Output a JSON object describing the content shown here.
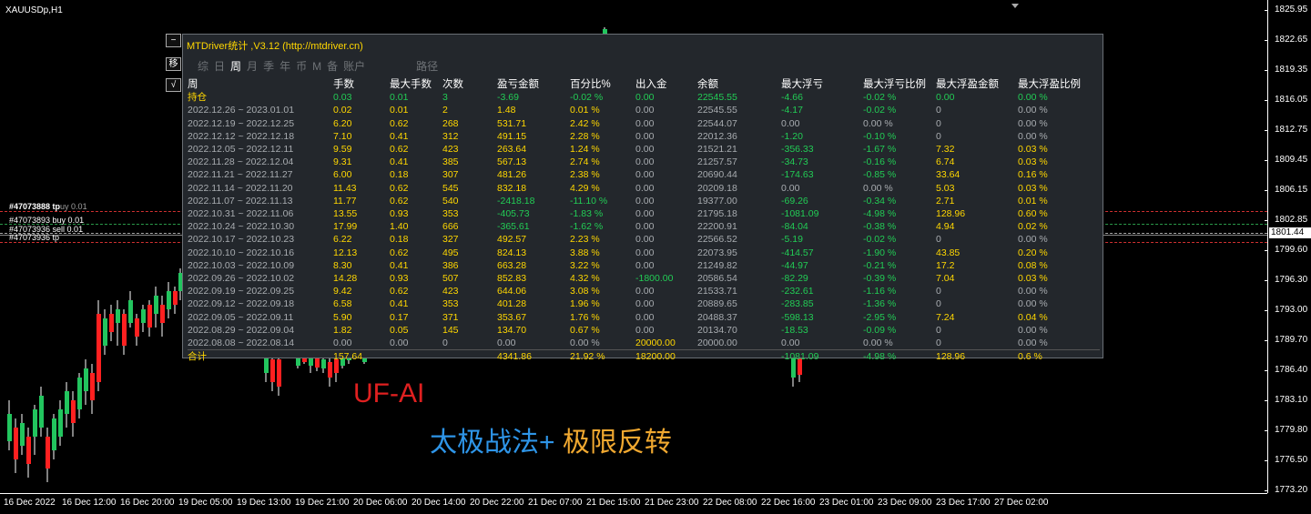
{
  "symbol": "XAUUSDp,H1",
  "colors": {
    "white": "#ffffff",
    "yellow": "#ffd700",
    "green": "#22cc55",
    "gray": "#a8acb0",
    "red": "#e03030"
  },
  "price_axis": {
    "ticks": [
      "1825.95",
      "1822.65",
      "1819.35",
      "1816.05",
      "1812.75",
      "1809.45",
      "1806.15",
      "1802.85",
      "1799.60",
      "1796.30",
      "1793.00",
      "1789.70",
      "1786.40",
      "1783.10",
      "1779.80",
      "1776.50",
      "1773.20"
    ],
    "current": "1801.44"
  },
  "time_axis": [
    "16 Dec 2022",
    "16 Dec 12:00",
    "16 Dec 20:00",
    "19 Dec 05:00",
    "19 Dec 13:00",
    "19 Dec 21:00",
    "20 Dec 06:00",
    "20 Dec 14:00",
    "20 Dec 22:00",
    "21 Dec 07:00",
    "21 Dec 15:00",
    "21 Dec 23:00",
    "22 Dec 08:00",
    "22 Dec 16:00",
    "23 Dec 01:00",
    "23 Dec 09:00",
    "23 Dec 17:00",
    "27 Dec 02:00"
  ],
  "orders": [
    "#47073888 tp",
    "#47073893 buy 0.01",
    "#47073936 sell 0.01",
    "#47073936 tp"
  ],
  "order_overlap": "uy 0.01",
  "side_buttons": [
    "−",
    "移",
    "√"
  ],
  "panel": {
    "title": "MTDriver统计 ,V3.12 (http://mtdriver.cn)",
    "tabs": [
      "综",
      "日",
      "周",
      "月",
      "季",
      "年",
      "币",
      "M",
      "备",
      "账户",
      "路径"
    ],
    "active_tab": "周",
    "headers": [
      "周",
      "手数",
      "最大手数",
      "次数",
      "盈亏金额",
      "百分比%",
      "出入金",
      "余额",
      "最大浮亏",
      "最大浮亏比例",
      "最大浮盈金额",
      "最大浮盈比例"
    ],
    "rows": [
      [
        "持仓",
        "0.03",
        "0.01",
        "3",
        "-3.69",
        "-0.02 %",
        "0.00",
        "22545.55",
        "-4.66",
        "-0.02 %",
        "0.00",
        "0.00 %"
      ],
      [
        "2022.12.26 ~ 2023.01.01",
        "0.02",
        "0.01",
        "2",
        "1.48",
        "0.01 %",
        "0.00",
        "22545.55",
        "-4.17",
        "-0.02 %",
        "0",
        "0.00 %"
      ],
      [
        "2022.12.19 ~ 2022.12.25",
        "6.20",
        "0.62",
        "268",
        "531.71",
        "2.42 %",
        "0.00",
        "22544.07",
        "0.00",
        "0.00 %",
        "0",
        "0.00 %"
      ],
      [
        "2022.12.12 ~ 2022.12.18",
        "7.10",
        "0.41",
        "312",
        "491.15",
        "2.28 %",
        "0.00",
        "22012.36",
        "-1.20",
        "-0.10 %",
        "0",
        "0.00 %"
      ],
      [
        "2022.12.05 ~ 2022.12.11",
        "9.59",
        "0.62",
        "423",
        "263.64",
        "1.24 %",
        "0.00",
        "21521.21",
        "-356.33",
        "-1.67 %",
        "7.32",
        "0.03 %"
      ],
      [
        "2022.11.28 ~ 2022.12.04",
        "9.31",
        "0.41",
        "385",
        "567.13",
        "2.74 %",
        "0.00",
        "21257.57",
        "-34.73",
        "-0.16 %",
        "6.74",
        "0.03 %"
      ],
      [
        "2022.11.21 ~ 2022.11.27",
        "6.00",
        "0.18",
        "307",
        "481.26",
        "2.38 %",
        "0.00",
        "20690.44",
        "-174.63",
        "-0.85 %",
        "33.64",
        "0.16 %"
      ],
      [
        "2022.11.14 ~ 2022.11.20",
        "11.43",
        "0.62",
        "545",
        "832.18",
        "4.29 %",
        "0.00",
        "20209.18",
        "0.00",
        "0.00 %",
        "5.03",
        "0.03 %"
      ],
      [
        "2022.11.07 ~ 2022.11.13",
        "11.77",
        "0.62",
        "540",
        "-2418.18",
        "-11.10 %",
        "0.00",
        "19377.00",
        "-69.26",
        "-0.34 %",
        "2.71",
        "0.01 %"
      ],
      [
        "2022.10.31 ~ 2022.11.06",
        "13.55",
        "0.93",
        "353",
        "-405.73",
        "-1.83 %",
        "0.00",
        "21795.18",
        "-1081.09",
        "-4.98 %",
        "128.96",
        "0.60 %"
      ],
      [
        "2022.10.24 ~ 2022.10.30",
        "17.99",
        "1.40",
        "666",
        "-365.61",
        "-1.62 %",
        "0.00",
        "22200.91",
        "-84.04",
        "-0.38 %",
        "4.94",
        "0.02 %"
      ],
      [
        "2022.10.17 ~ 2022.10.23",
        "6.22",
        "0.18",
        "327",
        "492.57",
        "2.23 %",
        "0.00",
        "22566.52",
        "-5.19",
        "-0.02 %",
        "0",
        "0.00 %"
      ],
      [
        "2022.10.10 ~ 2022.10.16",
        "12.13",
        "0.62",
        "495",
        "824.13",
        "3.88 %",
        "0.00",
        "22073.95",
        "-414.57",
        "-1.90 %",
        "43.85",
        "0.20 %"
      ],
      [
        "2022.10.03 ~ 2022.10.09",
        "8.30",
        "0.41",
        "386",
        "663.28",
        "3.22 %",
        "0.00",
        "21249.82",
        "-44.97",
        "-0.21 %",
        "17.2",
        "0.08 %"
      ],
      [
        "2022.09.26 ~ 2022.10.02",
        "14.28",
        "0.93",
        "507",
        "852.83",
        "4.32 %",
        "-1800.00",
        "20586.54",
        "-82.29",
        "-0.39 %",
        "7.04",
        "0.03 %"
      ],
      [
        "2022.09.19 ~ 2022.09.25",
        "9.42",
        "0.62",
        "423",
        "644.06",
        "3.08 %",
        "0.00",
        "21533.71",
        "-232.61",
        "-1.16 %",
        "0",
        "0.00 %"
      ],
      [
        "2022.09.12 ~ 2022.09.18",
        "6.58",
        "0.41",
        "353",
        "401.28",
        "1.96 %",
        "0.00",
        "20889.65",
        "-283.85",
        "-1.36 %",
        "0",
        "0.00 %"
      ],
      [
        "2022.09.05 ~ 2022.09.11",
        "5.90",
        "0.17",
        "371",
        "353.67",
        "1.76 %",
        "0.00",
        "20488.37",
        "-598.13",
        "-2.95 %",
        "7.24",
        "0.04 %"
      ],
      [
        "2022.08.29 ~ 2022.09.04",
        "1.82",
        "0.05",
        "145",
        "134.70",
        "0.67 %",
        "0.00",
        "20134.70",
        "-18.53",
        "-0.09 %",
        "0",
        "0.00 %"
      ],
      [
        "2022.08.08 ~ 2022.08.14",
        "0.00",
        "0.00",
        "0",
        "0.00",
        "0.00 %",
        "20000.00",
        "20000.00",
        "0.00",
        "0.00 %",
        "0",
        "0.00 %"
      ]
    ],
    "total": [
      "合计",
      "157.64",
      "",
      "",
      "4341.86",
      "21.92 %",
      "18200.00",
      "",
      "-1081.09",
      "-4.98 %",
      "128.96",
      "0.6 %"
    ]
  },
  "overlay": {
    "brand": "UF-AI",
    "tagline_part1": "太极战法+",
    "tagline_part2": " 极限反转"
  }
}
